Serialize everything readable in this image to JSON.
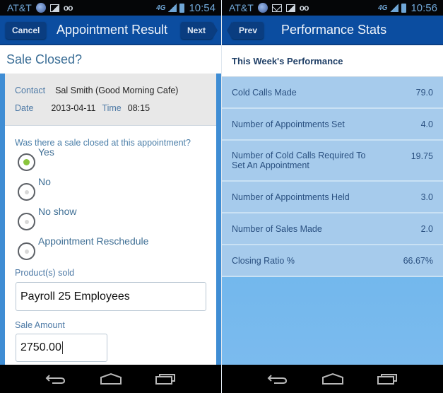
{
  "left": {
    "status_bar": {
      "carrier": "AT&T",
      "icons": [
        "globe-icon",
        "picture-icon",
        "voicemail-icon"
      ],
      "voicemail_glyph": "oo",
      "network": "4G",
      "time": "10:54"
    },
    "action_bar": {
      "title": "Appointment Result",
      "cancel_label": "Cancel",
      "next_label": "Next"
    },
    "page_title": "Sale Closed?",
    "info": {
      "contact_label": "Contact",
      "contact_value": "Sal Smith (Good Morning Cafe)",
      "date_label": "Date",
      "date_value": "2013-04-11",
      "time_label": "Time",
      "time_value": "08:15"
    },
    "question": "Was there a sale closed at this appointment?",
    "options": [
      {
        "label": "Yes",
        "checked": true
      },
      {
        "label": "No",
        "checked": false
      },
      {
        "label": "No show",
        "checked": false
      },
      {
        "label": "Appointment Reschedule",
        "checked": false
      }
    ],
    "products_label": "Product(s) sold",
    "products_value": "Payroll 25 Employees",
    "amount_label": "Sale Amount",
    "amount_value": "2750.00"
  },
  "right": {
    "status_bar": {
      "carrier": "AT&T",
      "icons": [
        "globe-icon",
        "mail-icon",
        "picture-icon",
        "voicemail-icon"
      ],
      "voicemail_glyph": "oo",
      "network": "4G",
      "time": "10:56"
    },
    "action_bar": {
      "title": "Performance Stats",
      "prev_label": "Prev"
    },
    "section_title": "This Week's Performance",
    "stats": [
      {
        "label": "Cold Calls Made",
        "value": "79.0"
      },
      {
        "label": "Number of Appointments Set",
        "value": "4.0"
      },
      {
        "label": "Number of Cold Calls Required To Set An Appointment",
        "value": "19.75"
      },
      {
        "label": "Number of Appointments Held",
        "value": "3.0"
      },
      {
        "label": "Number of Sales Made",
        "value": "2.0"
      },
      {
        "label": "Closing Ratio %",
        "value": "66.67%"
      }
    ]
  },
  "colors": {
    "action_bar": "#0b4da0",
    "accent_blue": "#3f8dd4",
    "radio_checked": "#8ac53c",
    "stat_row_bg": "#a6cbec"
  }
}
